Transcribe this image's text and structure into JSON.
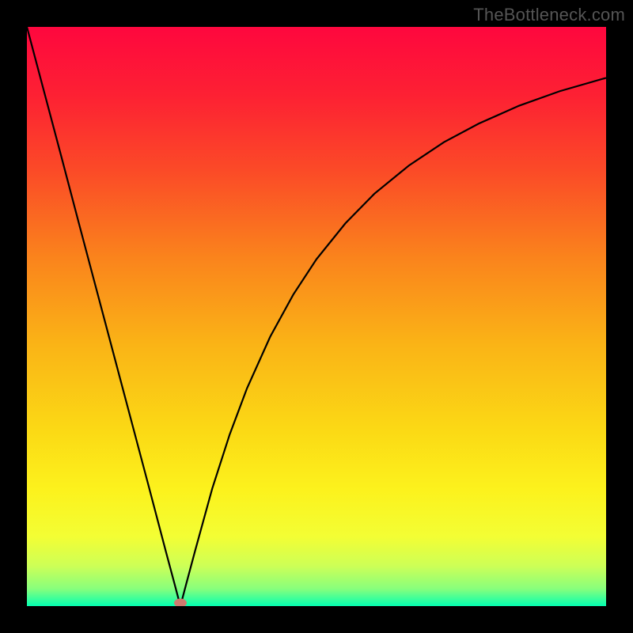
{
  "watermark": "TheBottleneck.com",
  "colors": {
    "frame": "#000000",
    "curve": "#000000",
    "marker_fill": "#cf7a6f",
    "gradient_stops": [
      {
        "offset": 0.0,
        "color": "#fe073e"
      },
      {
        "offset": 0.12,
        "color": "#fd2133"
      },
      {
        "offset": 0.25,
        "color": "#fb4b27"
      },
      {
        "offset": 0.4,
        "color": "#fa841c"
      },
      {
        "offset": 0.55,
        "color": "#fab416"
      },
      {
        "offset": 0.7,
        "color": "#fbda15"
      },
      {
        "offset": 0.8,
        "color": "#fcf21d"
      },
      {
        "offset": 0.88,
        "color": "#f3fe34"
      },
      {
        "offset": 0.93,
        "color": "#ceff56"
      },
      {
        "offset": 0.97,
        "color": "#88ff7c"
      },
      {
        "offset": 1.0,
        "color": "#04ffb1"
      }
    ]
  },
  "chart_data": {
    "type": "line",
    "title": "",
    "xlabel": "",
    "ylabel": "",
    "xlim": [
      0,
      100
    ],
    "ylim": [
      0,
      100
    ],
    "minimum_marker": {
      "x": 26.5,
      "y": 0
    },
    "series": [
      {
        "name": "curve",
        "x": [
          0,
          3,
          6,
          9,
          12,
          15,
          18,
          21,
          24,
          25.5,
          26.5,
          27.5,
          29,
          32,
          35,
          38,
          42,
          46,
          50,
          55,
          60,
          66,
          72,
          78,
          85,
          92,
          100
        ],
        "values": [
          100,
          88.7,
          77.4,
          66.0,
          54.7,
          43.4,
          32.1,
          20.8,
          9.4,
          3.8,
          0.0,
          3.8,
          9.4,
          20.3,
          29.6,
          37.6,
          46.5,
          53.8,
          59.9,
          66.1,
          71.2,
          76.1,
          80.1,
          83.3,
          86.4,
          88.9,
          91.2
        ]
      }
    ]
  }
}
